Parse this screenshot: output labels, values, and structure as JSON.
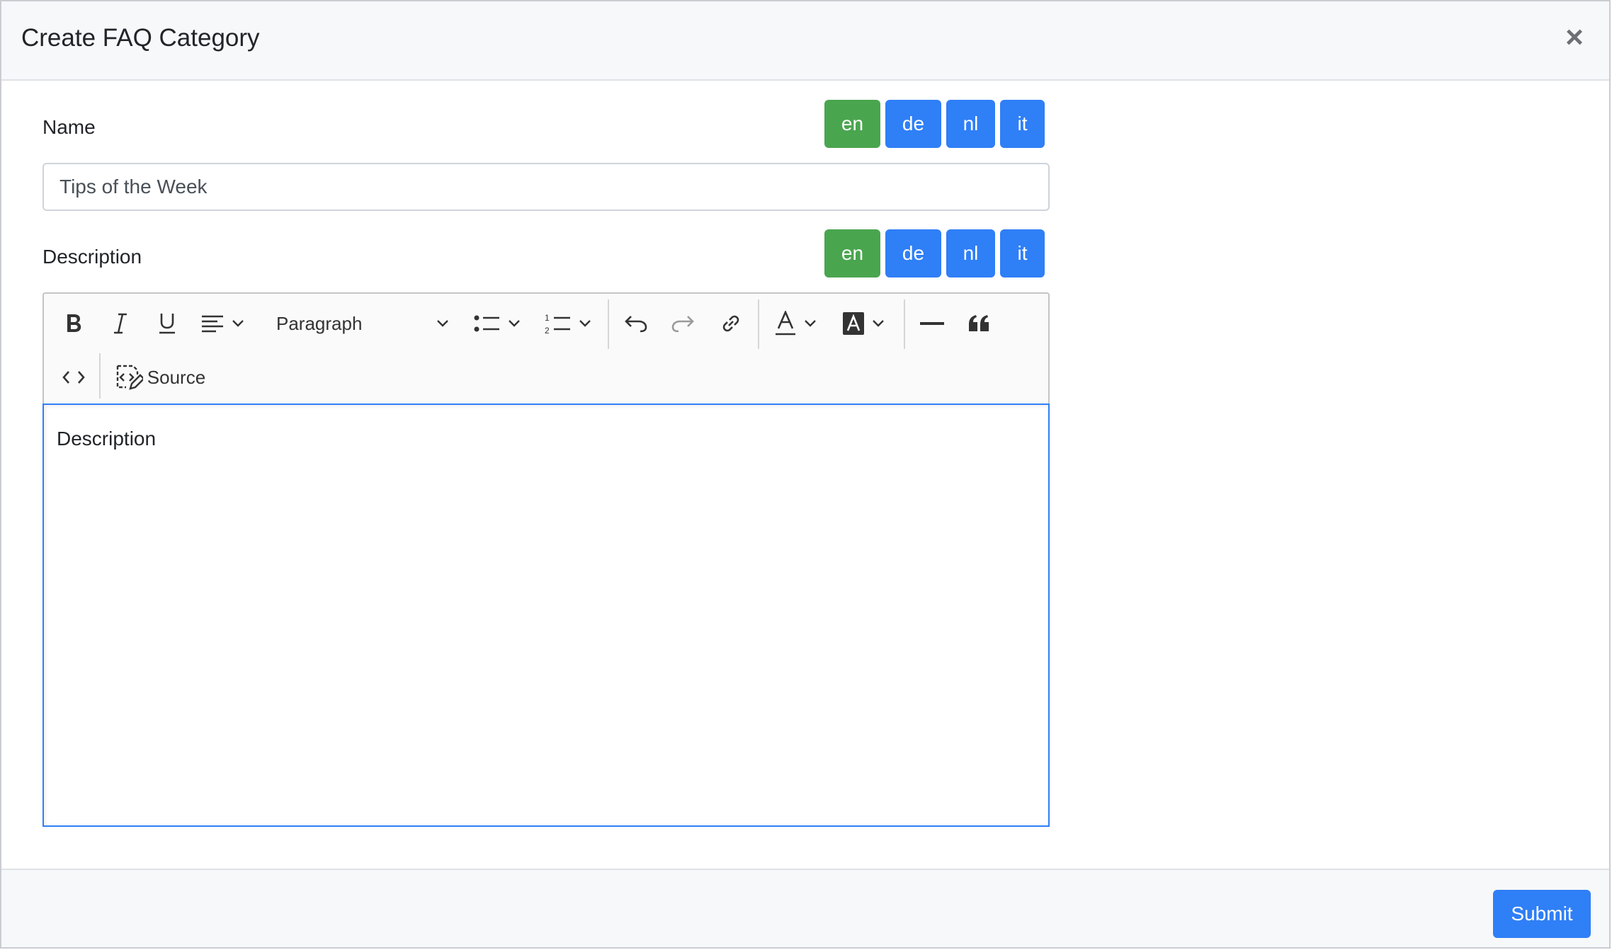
{
  "modal": {
    "title": "Create FAQ Category",
    "close_label": "×"
  },
  "name_field": {
    "label": "Name",
    "value": "Tips of the Week",
    "languages": [
      {
        "code": "en",
        "active": true
      },
      {
        "code": "de",
        "active": false
      },
      {
        "code": "nl",
        "active": false
      },
      {
        "code": "it",
        "active": false
      }
    ]
  },
  "description_field": {
    "label": "Description",
    "languages": [
      {
        "code": "en",
        "active": true
      },
      {
        "code": "de",
        "active": false
      },
      {
        "code": "nl",
        "active": false
      },
      {
        "code": "it",
        "active": false
      }
    ],
    "editor": {
      "block_format": "Paragraph",
      "source_label": "Source",
      "content": "Description",
      "toolbar_icons": [
        "bold-icon",
        "italic-icon",
        "underline-icon",
        "align-icon",
        "numbered-list-icon",
        "bulleted-list-icon",
        "undo-icon",
        "redo-icon",
        "link-icon",
        "font-color-icon",
        "font-background-icon",
        "horizontal-line-icon",
        "blockquote-icon",
        "code-block-icon",
        "source-edit-icon"
      ]
    }
  },
  "footer": {
    "submit_label": "Submit"
  },
  "colors": {
    "active_lang": "#4aa54f",
    "primary": "#2f7ff6"
  }
}
